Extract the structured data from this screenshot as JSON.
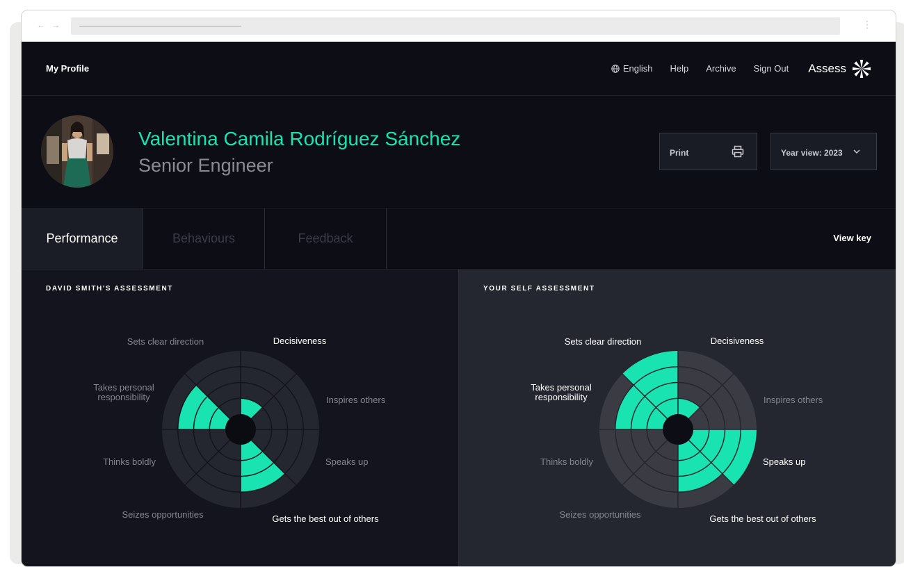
{
  "header": {
    "my_profile": "My Profile",
    "language": "English",
    "help": "Help",
    "archive": "Archive",
    "sign_out": "Sign Out",
    "brand": "Assess"
  },
  "profile": {
    "name": "Valentina Camila Rodríguez Sánchez",
    "role": "Senior Engineer",
    "print_label": "Print",
    "year_view_label": "Year view: 2023"
  },
  "tabs": [
    "Performance",
    "Behaviours",
    "Feedback"
  ],
  "active_tab": "Performance",
  "view_key": "View key",
  "colors": {
    "accent": "#19e3b0",
    "background": "#0d0e15",
    "wheel_base_left": "#252730",
    "wheel_base_right": "#3a3b43"
  },
  "chart_data": [
    {
      "type": "radial-bar",
      "title": "DAVID SMITH'S ASSESSMENT",
      "categories": [
        "Decisiveness",
        "Inspires others",
        "Speaks up",
        "Gets the best out of others",
        "Seizes opportunities",
        "Thinks boldly",
        "Takes personal responsibility",
        "Sets clear direction"
      ],
      "highlighted": [
        true,
        false,
        false,
        true,
        false,
        false,
        false,
        false
      ],
      "values": [
        1,
        0,
        0,
        3,
        0,
        0,
        3,
        0
      ],
      "max": 4
    },
    {
      "type": "radial-bar",
      "title": "YOUR SELF ASSESSMENT",
      "categories": [
        "Decisiveness",
        "Inspires others",
        "Speaks up",
        "Gets the best out of others",
        "Seizes opportunities",
        "Thinks boldly",
        "Takes personal responsibility",
        "Sets clear direction"
      ],
      "highlighted": [
        true,
        false,
        true,
        true,
        false,
        false,
        true,
        true
      ],
      "values": [
        1,
        0,
        4,
        3,
        0,
        0,
        3,
        4
      ],
      "max": 4
    }
  ]
}
